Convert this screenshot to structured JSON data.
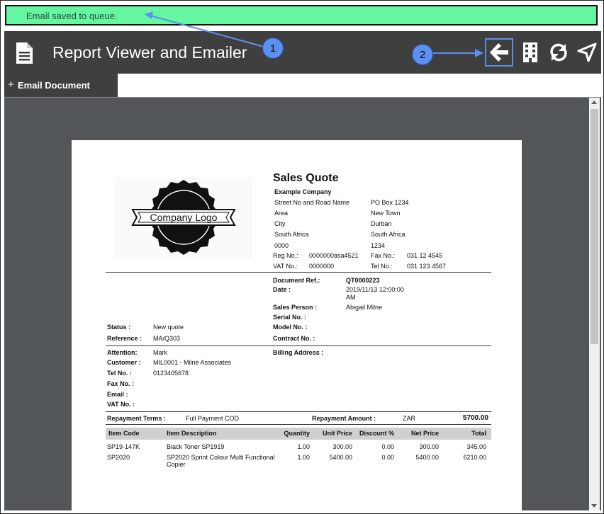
{
  "notification": {
    "message": "Email saved to queue."
  },
  "header": {
    "title": "Report Viewer and Emailer"
  },
  "callouts": [
    "1",
    "2"
  ],
  "toolbar": {
    "icons": [
      "back-arrow-icon",
      "building-icon",
      "refresh-icon",
      "navigate-icon"
    ]
  },
  "tabs": {
    "email_document": {
      "plus": "+",
      "label": "Email Document"
    }
  },
  "document": {
    "title": "Sales Quote",
    "company": {
      "name": "Example Company",
      "street": "Street No and Road Name",
      "area": "Area",
      "city": "City",
      "country": "South Africa",
      "postal": "0000",
      "po_box": "PO Box 1234",
      "town": "New Town",
      "city2": "Durban",
      "country2": "South Africa",
      "code2": "1234",
      "reg_label": "Reg No.:",
      "reg_value": "0000000asa4521",
      "fax_label": "Fax No.:",
      "fax_value": "031 12 4545",
      "vat_label": "VAT No.:",
      "vat_value": "0000000",
      "tel_label": "Tel No.:",
      "tel_value": "031 123 4567",
      "logo_text": "Company Logo"
    },
    "meta": {
      "doc_ref_label": "Document Ref.:",
      "doc_ref_value": "QT0000223",
      "date_label": "Date :",
      "date_value_line1": "2019/11/13 12:00:00",
      "date_value_line2": "AM",
      "sales_person_label": "Sales Person :",
      "sales_person_value": "Abigail Milne",
      "serial_label": "Serial No. :",
      "model_label": "Model No. :",
      "contract_label": "Contract No. :",
      "status_label": "Status :",
      "status_value": "New quote",
      "reference_label": "Reference :",
      "reference_value": "MA/Q303"
    },
    "customer": {
      "attention_label": "Attention:",
      "attention_value": "Mark",
      "customer_label": "Customer :",
      "customer_value": "MIL0001 - Milne Associates",
      "tel_label": "Tel No. :",
      "tel_value": "0123405678",
      "fax_label": "Fax No. :",
      "email_label": "Email :",
      "vat_label": "VAT No. :",
      "billing_label": "Billing Address :"
    },
    "repayment": {
      "terms_label": "Repayment Terms :",
      "terms_value": "Full Payment COD",
      "amount_label": "Repayment Amount :",
      "currency": "ZAR",
      "amount": "5700.00"
    },
    "items": {
      "headers": [
        "Item Code",
        "Item Description",
        "Quantity",
        "Unit Price",
        "Discount %",
        "Net Price",
        "Total"
      ],
      "rows": [
        {
          "code": "SP19-147K",
          "desc1": "Black Toner SP1919",
          "desc2": "",
          "qty": "1.00",
          "unit": "300.00",
          "disc": "0.00",
          "net": "300.00",
          "total": "345.00"
        },
        {
          "code": "SP2020",
          "desc1": "SP2020 Sprint Colour Multi Functional",
          "desc2": "Copier",
          "qty": "1.00",
          "unit": "5400.00",
          "disc": "0.00",
          "net": "5400.00",
          "total": "6210.00"
        }
      ]
    }
  }
}
